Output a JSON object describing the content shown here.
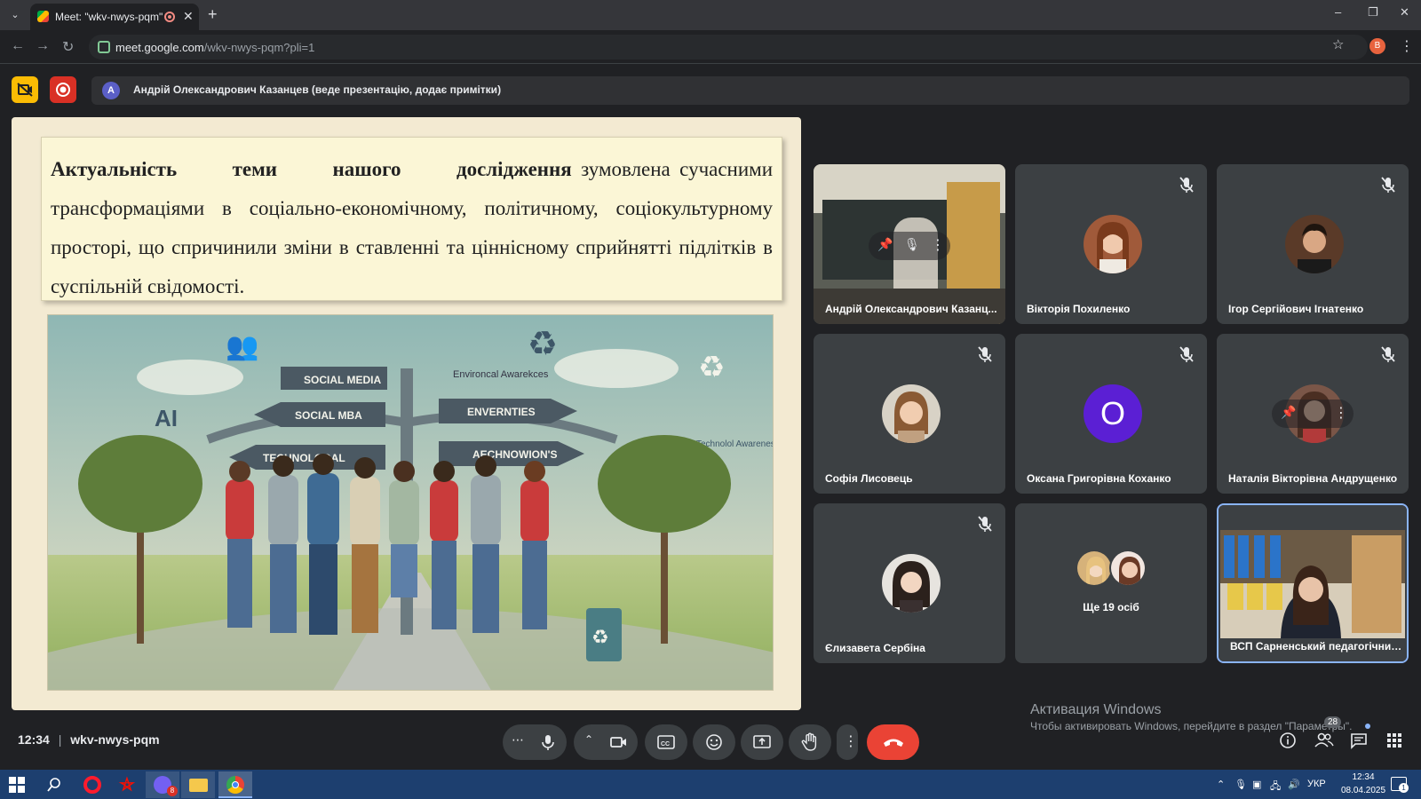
{
  "browser": {
    "tab_title": "Meet: \"wkv-nwys-pqm\"",
    "tab_close": "✕",
    "new_tab": "+",
    "url_domain": "meet.google.com",
    "url_path": "/wkv-nwys-pqm?pli=1",
    "profile_initial": "B",
    "window_controls": [
      "–",
      "❐",
      "✕"
    ]
  },
  "banner": {
    "presenter_initial": "A",
    "presenter_text": "Андрій Олександрович Казанцев (веде презентацію, додає примітки)"
  },
  "slide": {
    "words": [
      "Актуальність",
      "теми",
      "нашого",
      "дослідження"
    ],
    "rest": " зумовлена сучасними трансформаціями в соціально-економічному, політичному, соціокультурному просторі, що спричинили зміни в ставленні та ціннісному сприйнятті підлітків в суспільній свідомості.",
    "illustration_labels": {
      "sign1": "SOCIAL MEDIA",
      "sign2": "SOCIAL MBA",
      "sign3": "TECHNOLOGAL",
      "sign4": "ENVERNTIES",
      "sign5": "AECHNOWION'S",
      "env": "Environcal Awarekces",
      "ai": "AI",
      "tech": "Technolol Awarenes"
    }
  },
  "participants": [
    {
      "name": "Андрій Олександрович Казанцев",
      "display": "Андрій Олександрович Казанц...",
      "video": true
    },
    {
      "name": "Вікторія Похиленко",
      "muted": true
    },
    {
      "name": "Ігор Сергійович Ігнатенко",
      "muted": true
    },
    {
      "name": "Софія Лисовець",
      "muted": true
    },
    {
      "name": "Оксана Григорівна Коханко",
      "initial": "О",
      "muted": true
    },
    {
      "name": "Наталія Вікторівна Андрущенко",
      "muted": true
    },
    {
      "name": "Єлизавета Сербіна",
      "muted": true
    },
    {
      "name": "Ще 19 осіб"
    },
    {
      "name": "ВСП Сарненський педагогічний коледж",
      "display": "ВСП Сарненський педагогічний...",
      "video": true,
      "active": true
    }
  ],
  "bottom": {
    "time": "12:34",
    "meeting_code": "wkv-nwys-pqm",
    "people_count": "28",
    "more": "⋯"
  },
  "watermark": {
    "title": "Активация Windows",
    "subtitle": "Чтобы активировать Windows, перейдите в раздел \"Параметры\"."
  },
  "taskbar": {
    "lang": "УКР",
    "time": "12:34",
    "date": "08.04.2025",
    "viber_badge": "8",
    "notif_count": "1"
  },
  "colors": {
    "meet_bg": "#202124",
    "tile_bg": "#3c4043",
    "end_call": "#ea4335",
    "taskbar": "#1d3f6f",
    "accent_blue": "#8ab4f8",
    "avatar_purple": "#5b1fd4"
  }
}
